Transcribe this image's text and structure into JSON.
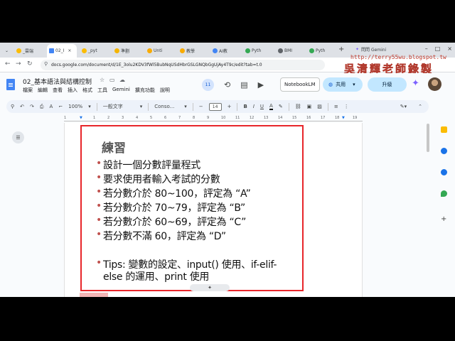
{
  "browser": {
    "tabs": [
      {
        "label": "_雲端",
        "color": "#fbbc04"
      },
      {
        "label": "02_I",
        "color": "#4285f4",
        "active": true
      },
      {
        "label": "_pyt",
        "color": "#fbbc04"
      },
      {
        "label": "準劃",
        "color": "#f4b400"
      },
      {
        "label": "Unti",
        "color": "#f9ab00"
      },
      {
        "label": "教學",
        "color": "#f9ab00"
      },
      {
        "label": "AI教",
        "color": "#4285f4"
      },
      {
        "label": "Pyth",
        "color": "#34a853"
      },
      {
        "label": "BMI",
        "color": "#5f6368"
      },
      {
        "label": "Pyth",
        "color": "#34a853"
      }
    ],
    "gemini_label": "問問 Gemini",
    "url": "docs.google.com/document/d/1E_3olu2KDV3fWl5BubNqUSdHbrGSLGNQbGgUjAy4T9c/edit?tab=t.0"
  },
  "watermark": {
    "url": "http://terry55wu.blogspot.tw",
    "title": "吳清輝老師錄製"
  },
  "docs": {
    "title": "02_基本語法與結構控制",
    "menu": [
      "檔案",
      "編輯",
      "查看",
      "插入",
      "格式",
      "工具",
      "Gemini",
      "擴充功能",
      "說明"
    ],
    "badge_count": "11",
    "notebooklm_label": "NotebookLM",
    "share_label": "共用",
    "upgrade_label": "升級"
  },
  "toolbar": {
    "zoom": "100%",
    "style": "一般文字",
    "font": "Conso...",
    "font_size": "14"
  },
  "ruler": [
    "1",
    "1",
    "2",
    "3",
    "4",
    "5",
    "6",
    "7",
    "8",
    "9",
    "10",
    "11",
    "12",
    "13",
    "14",
    "15",
    "16",
    "17",
    "18",
    "19"
  ],
  "slide": {
    "title": "練習",
    "bullets": [
      "設計一個分數評量程式",
      "要求使用者輸入考試的分數",
      "若分數介於 80~100，評定為 “A”",
      "若分數介於 70~79，評定為 “B”",
      "若分數介於 60~69，評定為 “C”",
      "若分數不滿 60，評定為 “D”"
    ],
    "tips_line1": "Tips: 變數的設定、input() 使用、if-elif-",
    "tips_line2": "else 的運用、print 使用"
  }
}
